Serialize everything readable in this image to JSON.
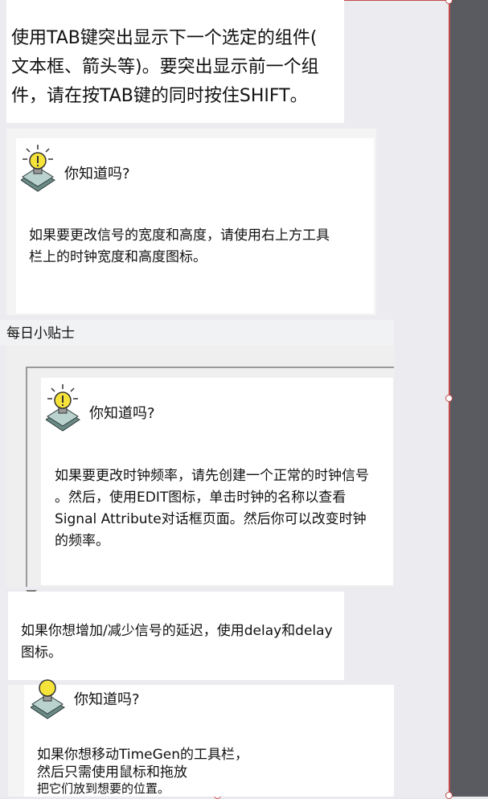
{
  "intro": {
    "text_lines": [
      "使用TAB键突出显示下一个选定的组件(",
      "文本框、箭头等)。要突出显示前一个组",
      "件，请在按TAB键的同时按住SHIFT。"
    ]
  },
  "card1": {
    "title": "你知道吗?",
    "body_lines": [
      "如果要更改信号的宽度和高度，请使用右上方工具",
      "栏上的时钟宽度和高度图标。"
    ]
  },
  "daily_tip_label": "每日小贴士",
  "card2": {
    "title": "你知道吗?",
    "body_lines": [
      "如果要更改时钟频率，请先创建一个正常的时钟信号",
      "。然后，使用EDIT图标，单击时钟的名称以查看",
      "Signal Attribute对话框页面。然后你可以改变时钟",
      "的频率。"
    ]
  },
  "card3": {
    "body_lines": [
      "如果你想增加/减少信号的延迟，使用delay和delay",
      "图标。"
    ]
  },
  "card4": {
    "title": "你知道吗?",
    "body_lines": [
      "如果你想移动TimeGen的工具栏，",
      "然后只需使用鼠标和拖放",
      "把它们放到想要的位置。"
    ]
  },
  "icons": {
    "bulb": "lightbulb-icon"
  },
  "colors": {
    "selection": "#c24a4a",
    "bulb_yellow": "#f6e33a",
    "bulb_base": "#6a8a86"
  }
}
